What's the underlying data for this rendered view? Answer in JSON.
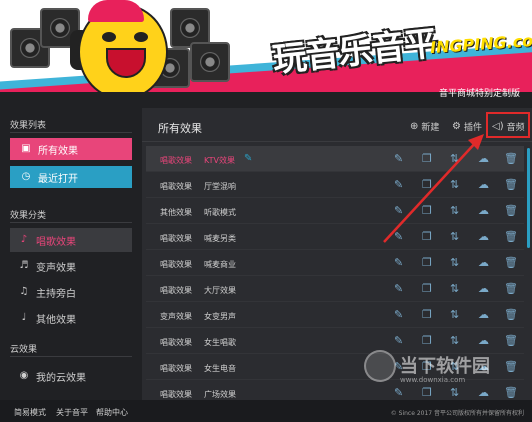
{
  "banner": {
    "logo_cn": "玩音乐音平",
    "logo_en": "INGPING.com",
    "edition": "音平商城特别定制版"
  },
  "sidebar": {
    "list_title": "效果列表",
    "all_effects": "所有效果",
    "recent": "最近打开",
    "category_title": "效果分类",
    "categories": [
      "唱歌效果",
      "变声效果",
      "主持旁白",
      "其他效果"
    ],
    "cloud_title": "云效果",
    "my_cloud": "我的云效果"
  },
  "main": {
    "title": "所有效果",
    "new_label": "新建",
    "plugin_label": "插件",
    "sound_label": "音频",
    "rows": [
      {
        "category": "唱歌效果",
        "name": "KTV效果"
      },
      {
        "category": "唱歌效果",
        "name": "厅堂混响"
      },
      {
        "category": "其他效果",
        "name": "听歌模式"
      },
      {
        "category": "唱歌效果",
        "name": "喊麦另类"
      },
      {
        "category": "唱歌效果",
        "name": "喊麦商业"
      },
      {
        "category": "唱歌效果",
        "name": "大厅效果"
      },
      {
        "category": "变声效果",
        "name": "女变男声"
      },
      {
        "category": "唱歌效果",
        "name": "女生唱歌"
      },
      {
        "category": "唱歌效果",
        "name": "女生电音"
      },
      {
        "category": "唱歌效果",
        "name": "广场效果"
      }
    ]
  },
  "watermark": {
    "text1": "当下软件园",
    "text2": "www.downxia.com"
  },
  "footer": {
    "simple_mode": "简易模式",
    "about": "关于音平",
    "help": "帮助中心",
    "copyright": "© Since 2017 音平公司版权所有并保留所有权利"
  },
  "colors": {
    "accent_pink": "#e8457a",
    "accent_blue": "#2a9fc4",
    "highlight_red": "#e02a2a"
  },
  "icons": {
    "edit": "pen-icon",
    "copy": "copy-icon",
    "sort": "sort-icon",
    "upload": "cloud-upload-icon",
    "delete": "trash-icon"
  }
}
